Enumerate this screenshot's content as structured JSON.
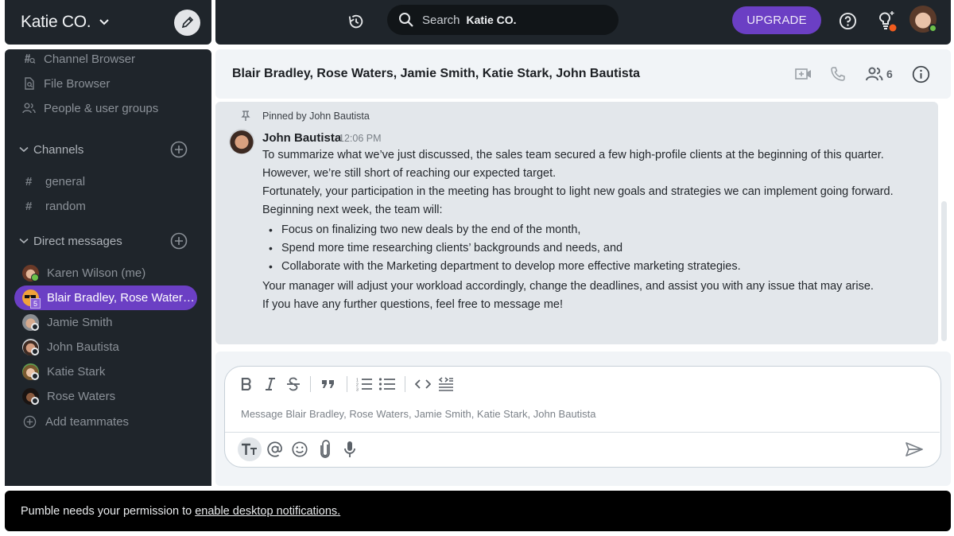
{
  "workspace": {
    "name": "Katie CO.",
    "compose_icon": "pencil-icon"
  },
  "topbar": {
    "history_icon": "history-icon",
    "search": {
      "label": "Search",
      "scope": "Katie CO."
    },
    "upgrade_label": "UPGRADE",
    "help_icon": "help-circle-icon",
    "whats_new_icon": "lightbulb-icon",
    "colors": {
      "upgrade": "#6b3fc4",
      "notification_dot": "#f25c1e",
      "online": "#6cc04a"
    }
  },
  "sidebar": {
    "nav": [
      {
        "label": "Channel Browser",
        "icon": "channel-browser-icon"
      },
      {
        "label": "File Browser",
        "icon": "file-browser-icon"
      },
      {
        "label": "People & user groups",
        "icon": "people-icon"
      }
    ],
    "channels_section": {
      "label": "Channels",
      "items": [
        {
          "label": "general"
        },
        {
          "label": "random"
        }
      ]
    },
    "dm_section": {
      "label": "Direct messages",
      "items": [
        {
          "label": "Karen Wilson (me)",
          "status": "online"
        },
        {
          "label": "Blair Bradley, Rose Water…",
          "status": "group",
          "group_count": "5",
          "active": true
        },
        {
          "label": "Jamie Smith",
          "status": "offline"
        },
        {
          "label": "John Bautista",
          "status": "offline"
        },
        {
          "label": "Katie Stark",
          "status": "offline"
        },
        {
          "label": "Rose Waters",
          "status": "offline"
        }
      ]
    },
    "add_teammates_label": "Add teammates"
  },
  "channel": {
    "title": "Blair Bradley, Rose Waters, Jamie Smith, Katie Stark, John Bautista",
    "member_count": "6"
  },
  "message": {
    "pinned_by": "Pinned by John Bautista",
    "author": "John Bautista",
    "time": "12:06 PM",
    "lines": [
      "To summarize what we’ve just discussed, the sales team secured a few high-profile clients at the beginning of this quarter.",
      "However, we’re still short of reaching our expected target.",
      "Fortunately, your participation in the meeting has brought to light new goals and strategies we can implement going forward.",
      "Beginning next week, the team will:"
    ],
    "bullets": [
      "Focus on finalizing two new deals by the end of the month,",
      "Spend more time researching clients’ backgrounds and needs, and",
      "Collaborate with the Marketing department to develop more effective marketing strategies."
    ],
    "closing": [
      "Your manager will adjust your workload accordingly, change the deadlines, and assist you with any issue that may arise.",
      "If you have any further questions, feel free to message me!"
    ]
  },
  "composer": {
    "placeholder": "Message Blair Bradley, Rose Waters, Jamie Smith, Katie Stark, John Bautista",
    "value": ""
  },
  "notification": {
    "text": "Pumble needs your permission to",
    "link": "enable desktop notifications."
  }
}
